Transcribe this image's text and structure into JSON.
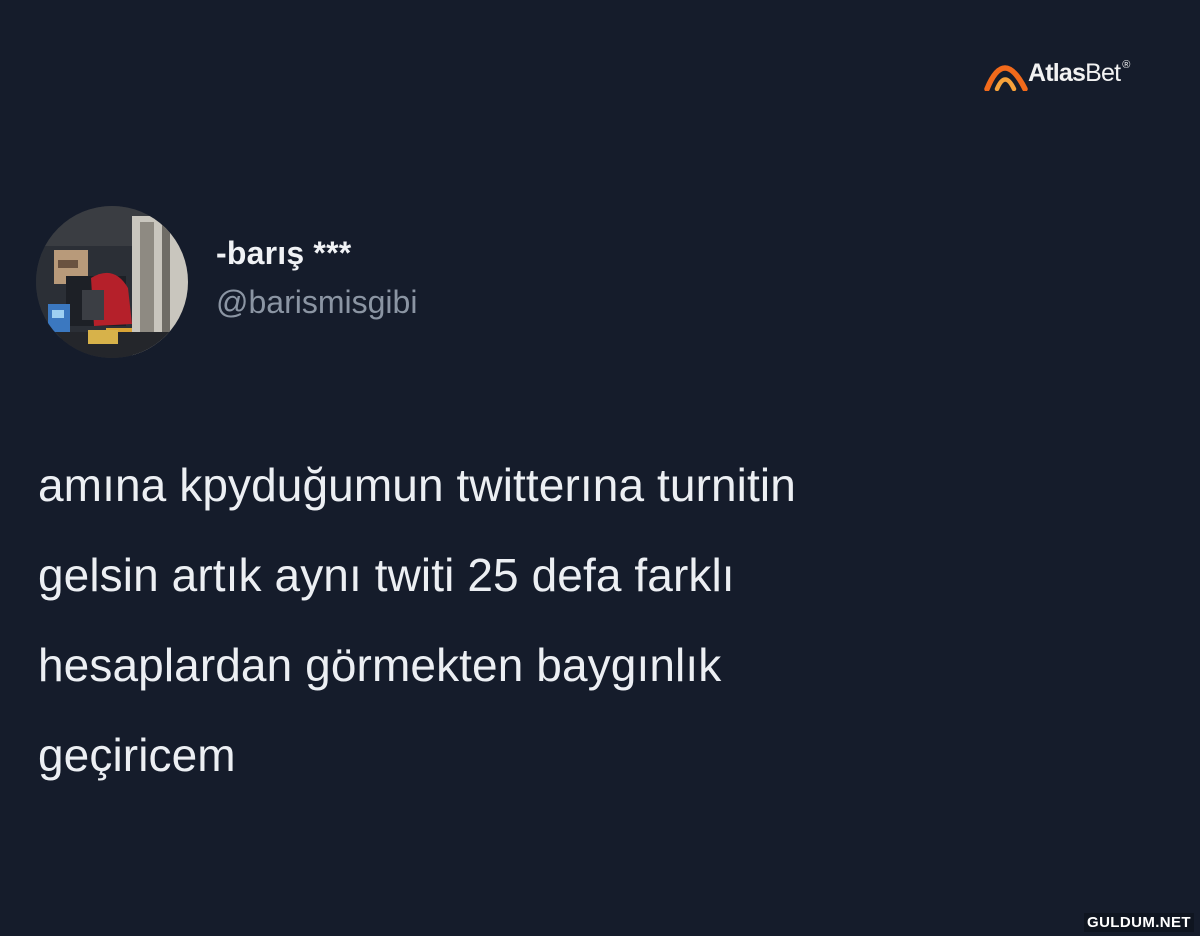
{
  "watermark": {
    "brand_strong": "Atlas",
    "brand_light": "Bet",
    "registered": "®",
    "site": "GULDUM.NET"
  },
  "tweet": {
    "display_name": "-barış ***",
    "handle": "@barismisgibi",
    "lines": [
      "amına kpyduğumun twitterına turnitin",
      "gelsin artık aynı twiti 25 defa farklı",
      "hesaplardan görmekten baygınlık",
      "geçiricem"
    ]
  },
  "colors": {
    "background": "#151c2b",
    "text": "#eceff3",
    "handle": "#8b95a3",
    "atlas_orange": "#f26a1b"
  }
}
